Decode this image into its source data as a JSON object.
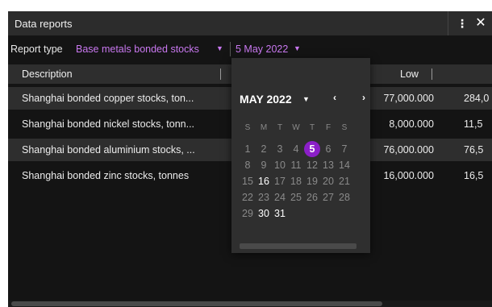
{
  "window": {
    "title": "Data reports"
  },
  "toolbar": {
    "report_type_label": "Report type",
    "report_type_value": "Base metals bonded stocks",
    "date_value": "5 May 2022"
  },
  "table": {
    "columns": [
      "Description",
      "Low"
    ],
    "rows": [
      {
        "description": "Shanghai bonded copper stocks, ton...",
        "low": "77,000.000",
        "next": "284,0"
      },
      {
        "description": "Shanghai bonded nickel stocks, tonn...",
        "low": "8,000.000",
        "next": "11,5"
      },
      {
        "description": "Shanghai bonded aluminium stocks, ...",
        "low": "76,000.000",
        "next": "76,5"
      },
      {
        "description": "Shanghai bonded zinc stocks, tonnes",
        "low": "16,000.000",
        "next": "16,5"
      }
    ]
  },
  "calendar": {
    "month_label": "MAY 2022",
    "weekdays": [
      "S",
      "M",
      "T",
      "W",
      "T",
      "F",
      "S"
    ],
    "weeks": [
      [
        "1",
        "2",
        "3",
        "4",
        "5",
        "6",
        "7"
      ],
      [
        "8",
        "9",
        "10",
        "11",
        "12",
        "13",
        "14"
      ],
      [
        "15",
        "16",
        "17",
        "18",
        "19",
        "20",
        "21"
      ],
      [
        "22",
        "23",
        "24",
        "25",
        "26",
        "27",
        "28"
      ],
      [
        "29",
        "30",
        "31"
      ]
    ],
    "selected_day": "5",
    "highlighted_days": [
      "16",
      "30",
      "31"
    ]
  },
  "colors": {
    "accent": "#c978f0",
    "selected_day_bg": "#8b1fc8",
    "panel_bg": "#141414",
    "titlebar_bg": "#2c2c2c",
    "dropdown_bg": "#2f2f2f"
  }
}
